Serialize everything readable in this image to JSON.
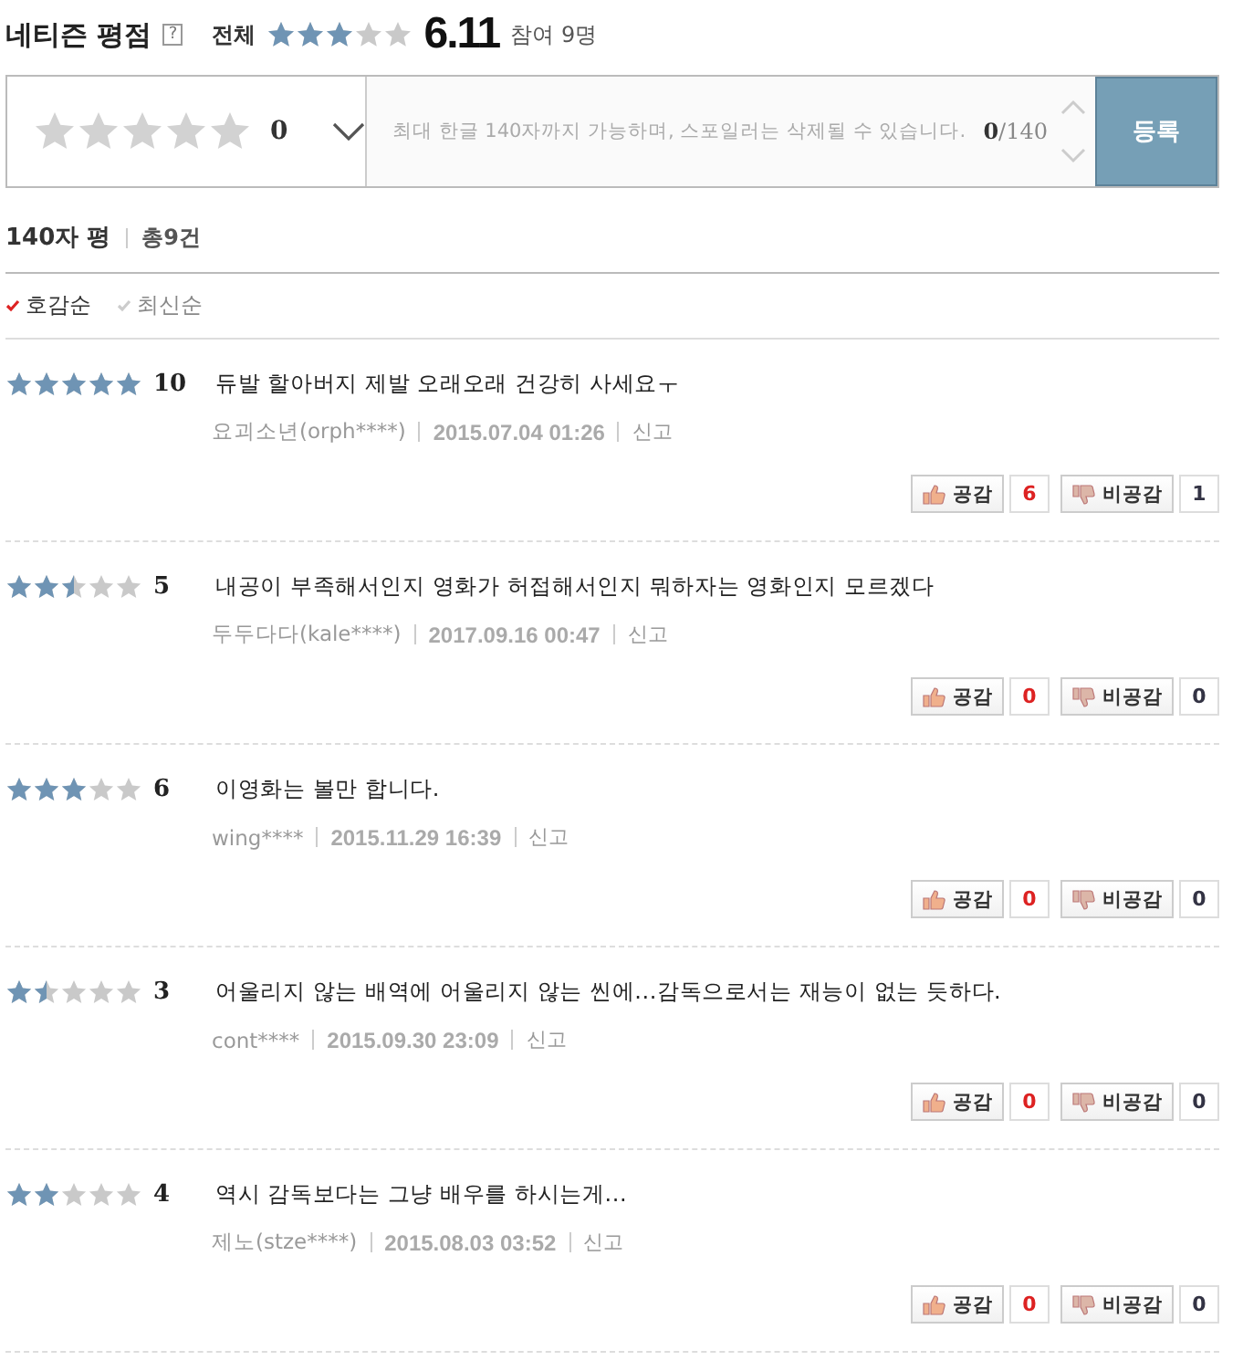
{
  "header": {
    "title": "네티즌 평점",
    "help": "?",
    "scope": "전체",
    "stars": 3,
    "score": "6.11",
    "participants": "참여 9명"
  },
  "composer": {
    "stars": 0,
    "score": "0",
    "placeholder": "최대 한글 140자까지 가능하며, 스포일러는 삭제될 수 있습니다.",
    "count": "0",
    "limit": "/140",
    "submit": "등록"
  },
  "summary": {
    "label": "140자 평",
    "total": "총9건"
  },
  "sort": [
    {
      "label": "호감순",
      "selected": true
    },
    {
      "label": "최신순",
      "selected": false
    }
  ],
  "reviews": [
    {
      "stars": 5,
      "score": "10",
      "text": "듀발 할아버지 제발 오래오래 건강히 사세요ㅜ",
      "author": "요괴소년(orph****)",
      "date": "2015.07.04 01:26",
      "report": "신고",
      "like_label": "공감",
      "likes": "6",
      "dislike_label": "비공감",
      "dislikes": "1"
    },
    {
      "stars": 2.5,
      "score": "5",
      "text": "내공이 부족해서인지 영화가 허접해서인지 뭐하자는 영화인지 모르겠다",
      "author": "두두다다(kale****)",
      "date": "2017.09.16 00:47",
      "report": "신고",
      "like_label": "공감",
      "likes": "0",
      "dislike_label": "비공감",
      "dislikes": "0"
    },
    {
      "stars": 3,
      "score": "6",
      "text": "이영화는 볼만 합니다.",
      "author": "wing****",
      "date": "2015.11.29 16:39",
      "report": "신고",
      "like_label": "공감",
      "likes": "0",
      "dislike_label": "비공감",
      "dislikes": "0"
    },
    {
      "stars": 1.5,
      "score": "3",
      "text": "어울리지 않는 배역에 어울리지 않는 씬에...감독으로서는 재능이 없는 듯하다.",
      "author": "cont****",
      "date": "2015.09.30 23:09",
      "report": "신고",
      "like_label": "공감",
      "likes": "0",
      "dislike_label": "비공감",
      "dislikes": "0"
    },
    {
      "stars": 2,
      "score": "4",
      "text": "역시 감독보다는 그냥 배우를 하시는게...",
      "author": "제노(stze****)",
      "date": "2015.08.03 03:52",
      "report": "신고",
      "like_label": "공감",
      "likes": "0",
      "dislike_label": "비공감",
      "dislikes": "0"
    }
  ]
}
